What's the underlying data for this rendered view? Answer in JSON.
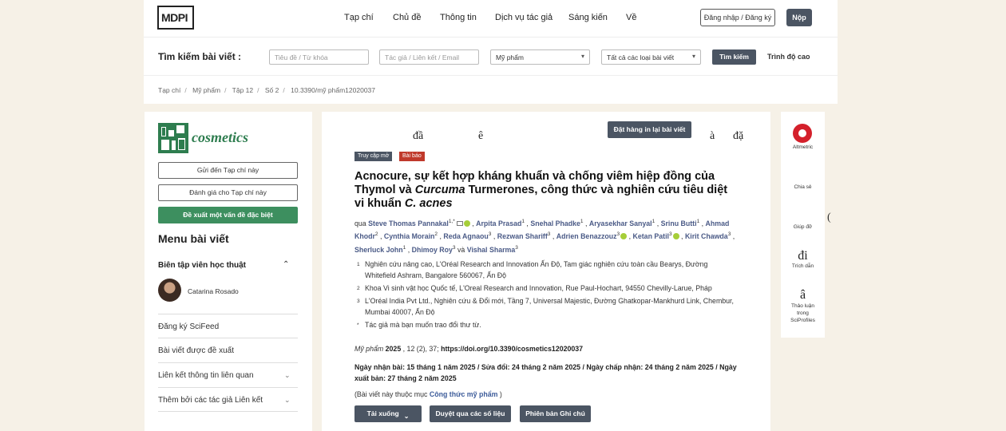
{
  "header": {
    "logo": "MDPI",
    "nav": [
      "Tạp chí",
      "Chủ đề",
      "Thông tin",
      "Dịch vụ tác giả",
      "Sáng kiến",
      "Về"
    ],
    "login_label": "Đăng nhập / Đăng ký",
    "submit_label": "Nộp"
  },
  "search": {
    "label": "Tìm kiếm bài viết :",
    "title_placeholder": "Tiêu đề / Từ khóa",
    "author_placeholder": "Tác giả / Liên kết / Email",
    "journal_value": "Mỹ phẩm",
    "type_value": "Tất cả các loại bài viết",
    "search_button": "Tìm kiếm",
    "advanced_label": "Trình độ cao"
  },
  "breadcrumb": [
    "Tạp chí",
    "Mỹ phẩm",
    "Tập 12",
    "Số 2",
    "10.3390/mỹ phẩm12020037"
  ],
  "sidebar": {
    "journal_name": "cosmetics",
    "buttons": [
      "Gửi đến Tạp chí này",
      "Đánh giá cho Tạp chí này",
      "Đề xuất một vấn đề đặc biệt"
    ],
    "menu_title": "Menu bài viết",
    "editor_heading": "Biên tập viên học thuật",
    "editor_name": "Catarina Rosado",
    "items": [
      "Đăng ký SciFeed",
      "Bài viết được đề xuất",
      "Liên kết thông tin liên quan",
      "Thêm bởi các tác giả Liên kết"
    ]
  },
  "article": {
    "garbled": [
      "đầ",
      "ê",
      "à",
      "đặ"
    ],
    "reprint_button": "Đặt hàng in lại bài viết",
    "badges": {
      "open_access": "Truy cập mở",
      "type": "Bài báo"
    },
    "title_part1": "Acnocure, sự kết hợp kháng khuẩn và chống viêm hiệp đồng của Thymol và ",
    "title_italic1": "Curcuma",
    "title_part2": " Turmerones, công thức và nghiên cứu tiêu diệt vi khuẩn ",
    "title_italic2": "C. acnes",
    "by_label": "qua",
    "and_label": "và",
    "authors": [
      {
        "name": "Steve Thomas Pannakal",
        "sup": "1,*",
        "email": true,
        "orcid": true
      },
      {
        "name": "Arpita Prasad",
        "sup": "1"
      },
      {
        "name": "Snehal Phadke",
        "sup": "1"
      },
      {
        "name": "Aryasekhar Sanyal",
        "sup": "1"
      },
      {
        "name": "Srinu Butti",
        "sup": "1"
      },
      {
        "name": "Ahmad Khodr",
        "sup": "2"
      },
      {
        "name": "Cynthia Morain",
        "sup": "2"
      },
      {
        "name": "Reda Agnaou",
        "sup": "3"
      },
      {
        "name": "Rezwan Shariff",
        "sup": "3"
      },
      {
        "name": "Adrien Benazzouz",
        "sup": "3",
        "orcid": true
      },
      {
        "name": "Ketan Patil",
        "sup": "3",
        "orcid": true
      },
      {
        "name": "Kirit Chawda",
        "sup": "3"
      },
      {
        "name": "Sherluck John",
        "sup": "1"
      },
      {
        "name": "Dhimoy Roy",
        "sup": "3"
      },
      {
        "name": "Vishal Sharma",
        "sup": "3"
      }
    ],
    "affiliations": [
      {
        "num": "1",
        "text": "Nghiên cứu nâng cao, L'Oréal Research and Innovation Ấn Độ, Tam giác nghiên cứu toàn cầu Bearys, Đường Whitefield Ashram, Bangalore 560067, Ấn Độ"
      },
      {
        "num": "2",
        "text": "Khoa Vi sinh vật học Quốc tế, L'Oreal Research and Innovation, Rue Paul-Hochart, 94550 Chevilly-Larue, Pháp"
      },
      {
        "num": "3",
        "text": "L'Oréal India Pvt Ltd., Nghiên cứu & Đổi mới, Tầng 7, Universal Majestic, Đường Ghatkopar-Mankhurd Link, Chembur, Mumbai 40007, Ấn Độ"
      },
      {
        "num": "*",
        "text": "Tác giả mà bạn muốn trao đổi thư từ."
      }
    ],
    "citation": {
      "journal": "Mỹ phẩm",
      "year": "2025",
      "rest": " , 12 (2), 37; ",
      "doi": "https://doi.org/10.3390/cosmetics12020037"
    },
    "dates": "Ngày nhận bài: 15 tháng 1 năm 2025 / Sửa đổi: 24 tháng 2 năm 2025 / Ngày chấp nhận: 24 tháng 2 năm 2025 / Ngày xuất bản: 27 tháng 2 năm 2025",
    "section_prefix": "(Bài viết này thuộc mục ",
    "section_link": "Công thức mỹ phẩm",
    "section_suffix": " )",
    "action_buttons": [
      "Tải xuống",
      "Duyệt qua các số liệu",
      "Phiên bản Ghi chú"
    ]
  },
  "right_rail": {
    "items": [
      "Altmetric",
      "Chia sẻ",
      "Giúp đỡ",
      "Trích dẫn",
      "Thảo luận trong SciProfiles"
    ],
    "glyphs": [
      "đi",
      "â"
    ],
    "edge_glyph": "("
  },
  "colors": {
    "accent": "#4b5563",
    "journal_green": "#2e7d4f",
    "badge_open": "#4b5563",
    "badge_article": "#c0392b",
    "altmetric": "#d4202b"
  }
}
